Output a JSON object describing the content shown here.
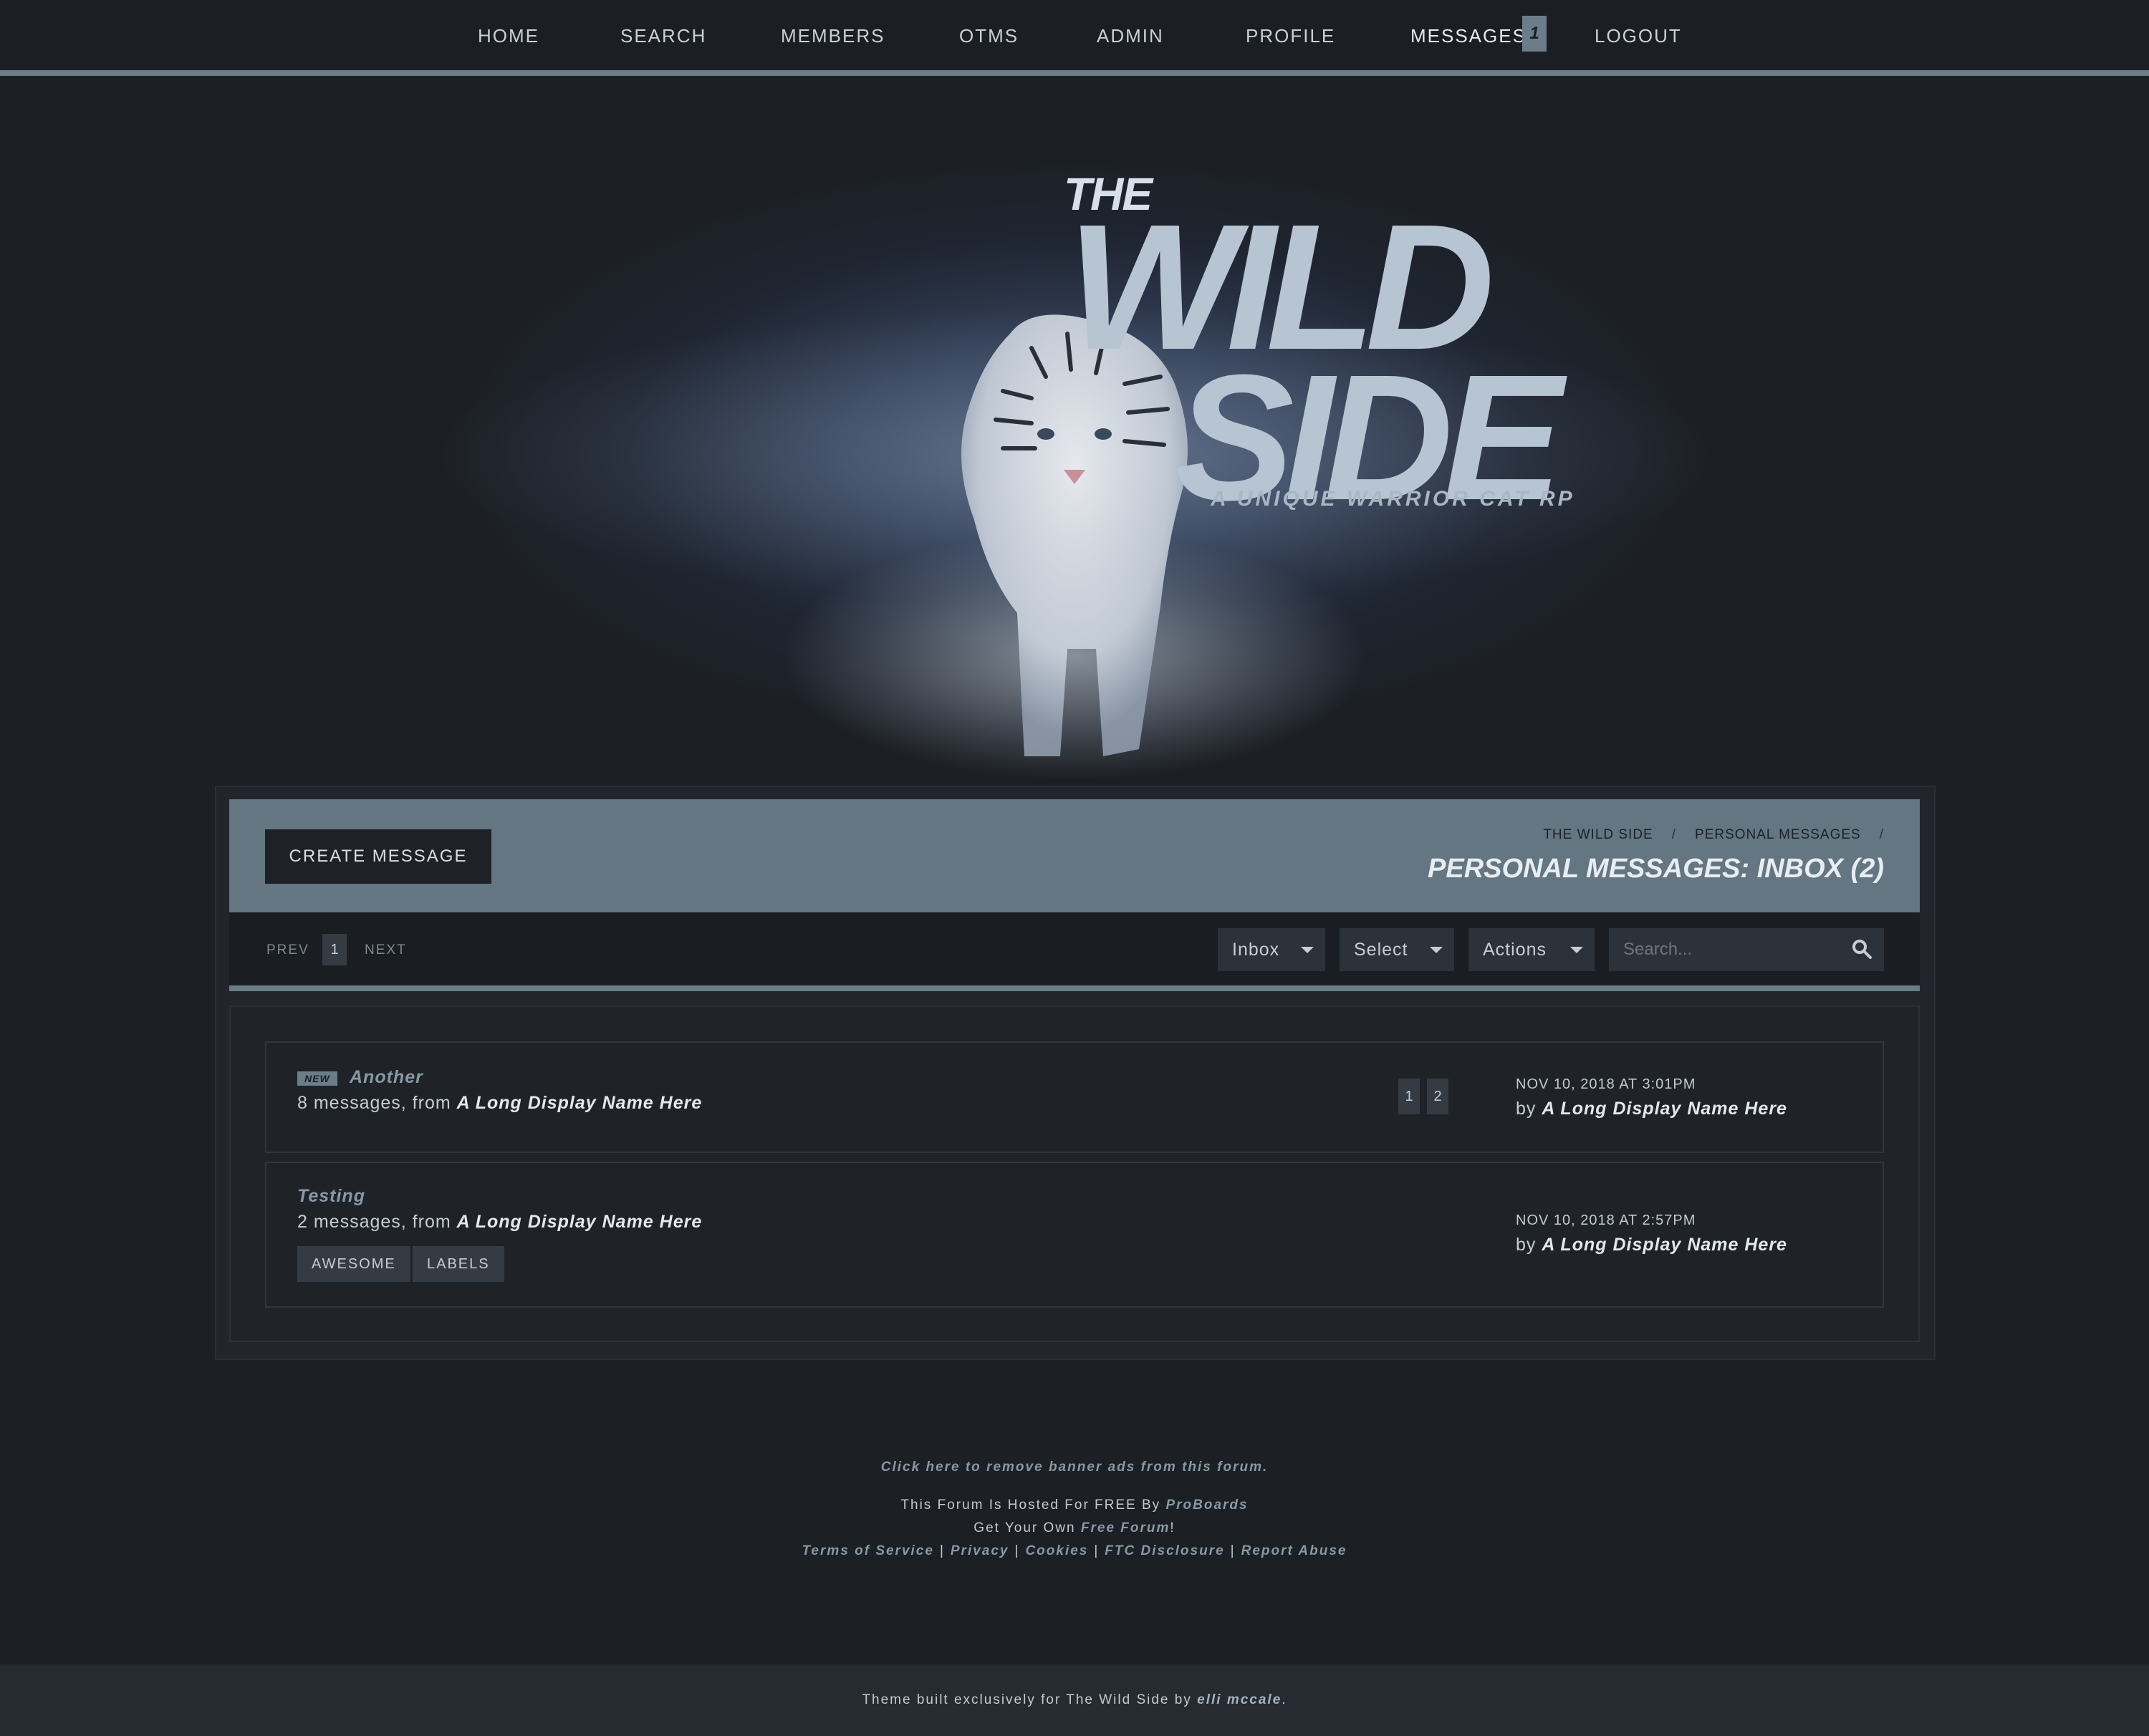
{
  "nav": {
    "items": [
      "HOME",
      "SEARCH",
      "MEMBERS",
      "OTMS",
      "ADMIN",
      "PROFILE",
      "MESSAGES",
      "LOGOUT"
    ],
    "messages_badge": "1"
  },
  "banner": {
    "logo_the": "THE",
    "logo_wild": "WILD",
    "logo_side": "SIDE",
    "tagline": "A UNIQUE WARRIOR CAT RP"
  },
  "header": {
    "create_button": "CREATE MESSAGE",
    "breadcrumbs": [
      "THE WILD SIDE",
      "PERSONAL MESSAGES"
    ],
    "title": "PERSONAL MESSAGES: INBOX (2)"
  },
  "toolbar": {
    "prev": "PREV",
    "page": "1",
    "next": "NEXT",
    "folder_select": "Inbox",
    "select_dropdown": "Select",
    "actions_dropdown": "Actions",
    "search_placeholder": "Search..."
  },
  "messages": [
    {
      "new_badge": "NEW",
      "subject": "Another",
      "count_text": "8 messages, from",
      "from": "A Long Display Name Here",
      "pages": [
        "1",
        "2"
      ],
      "date": "NOV 10, 2018 AT 3:01PM",
      "by_prefix": "by",
      "by": "A Long Display Name Here"
    },
    {
      "subject": "Testing",
      "count_text": "2 messages, from",
      "from": "A Long Display Name Here",
      "labels": [
        "AWESOME",
        "LABELS"
      ],
      "date": "NOV 10, 2018 AT 2:57PM",
      "by_prefix": "by",
      "by": "A Long Display Name Here"
    }
  ],
  "footer": {
    "remove_ads": "Click here to remove banner ads from this forum.",
    "hosted_prefix": "This Forum Is Hosted For FREE By",
    "hosted_link": "ProBoards",
    "own_prefix": "Get Your Own",
    "own_link": "Free Forum",
    "own_suffix": "!",
    "links": [
      "Terms of Service",
      "Privacy",
      "Cookies",
      "FTC Disclosure",
      "Report Abuse"
    ],
    "credit_prefix": "Theme built exclusively for The Wild Side by",
    "credit_author": "elli mccale",
    "credit_suffix": "."
  },
  "colors": {
    "accent": "#6a7d88",
    "header_bar": "#637682",
    "background": "#1c1f24",
    "link": "#8799a6"
  }
}
